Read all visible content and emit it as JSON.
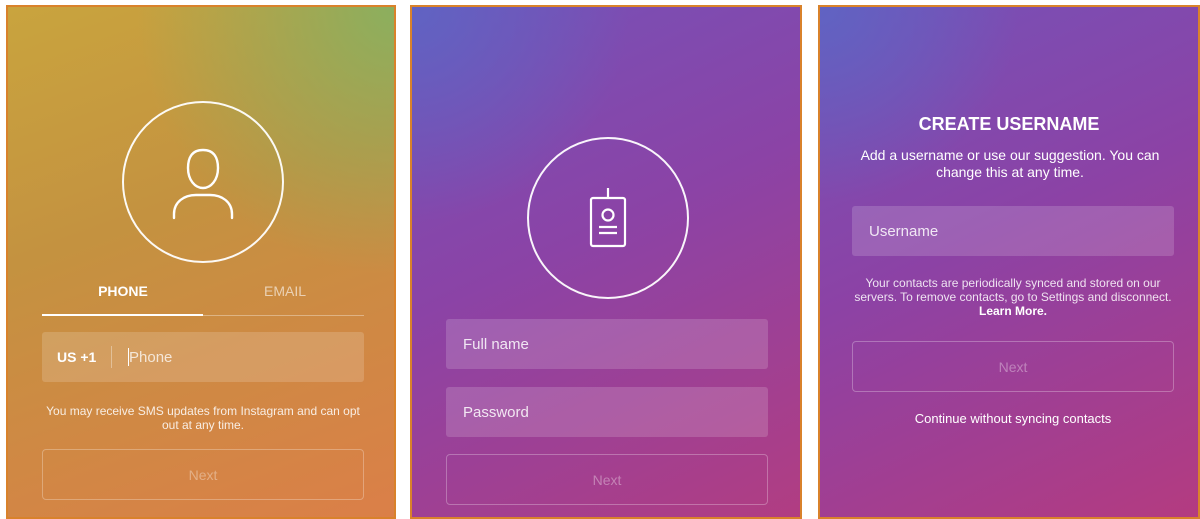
{
  "phone_screen": {
    "tabs": [
      {
        "label": "PHONE",
        "active": true
      },
      {
        "label": "EMAIL",
        "active": false
      }
    ],
    "country_code": "US +1",
    "phone_placeholder": "Phone",
    "sms_notice": "You may receive SMS updates from Instagram and can opt out at any time.",
    "next_label": "Next",
    "icon": "user-icon"
  },
  "signup_screen": {
    "full_name_placeholder": "Full name",
    "password_placeholder": "Password",
    "next_label": "Next",
    "icon": "id-badge-icon"
  },
  "username_screen": {
    "title": "CREATE USERNAME",
    "subtitle": "Add a username or use our suggestion. You can change this at any time.",
    "username_placeholder": "Username",
    "contacts_notice": "Your contacts are periodically synced and stored on our servers. To remove contacts, go to Settings and disconnect.",
    "learn_more_label": "Learn More.",
    "next_label": "Next",
    "continue_label": "Continue without syncing contacts"
  },
  "colors": {
    "panel1_gradient": [
      "#c9a43e",
      "#88b060",
      "#db7f48"
    ],
    "panel2_gradient": [
      "#5f64c3",
      "#8b43a6",
      "#b13d82"
    ],
    "panel_border": "#d9822b",
    "text": "#ffffff"
  }
}
